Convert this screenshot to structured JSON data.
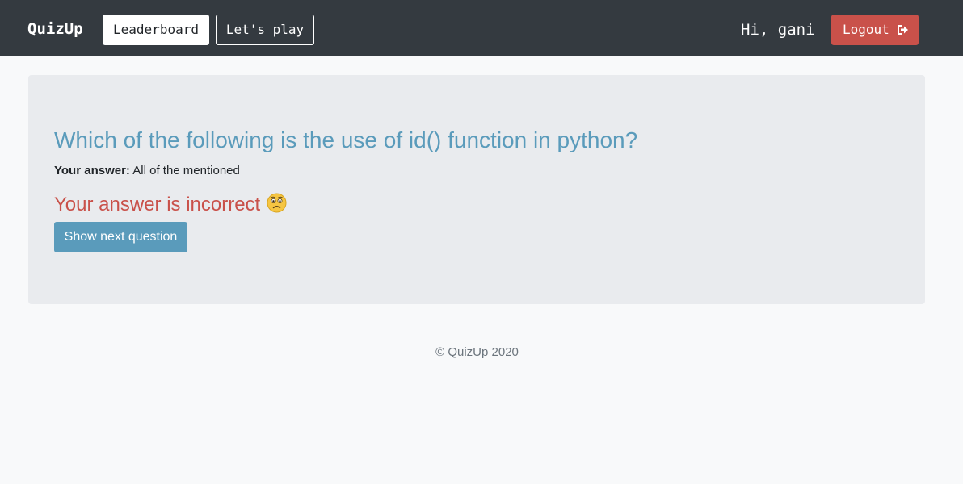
{
  "navbar": {
    "brand": "QuizUp",
    "leaderboard_label": "Leaderboard",
    "play_label": "Let's play",
    "greeting": "Hi, gani",
    "logout_label": "Logout",
    "logout_icon": "sign-out-icon",
    "background_color": "#343a40"
  },
  "quiz": {
    "question": "Which of the following is the use of id() function in python?",
    "answer_label": "Your answer:",
    "answer_value": "All of the mentioned",
    "result_text": "Your answer is incorrect",
    "result_icon": "worried-face-emoji",
    "next_button_label": "Show next question"
  },
  "footer": {
    "copyright": "© QuizUp 2020"
  },
  "colors": {
    "accent": "#5a9bbb",
    "danger": "#c9514a",
    "panel": "#e9ebee",
    "page": "#f8f9fa"
  }
}
